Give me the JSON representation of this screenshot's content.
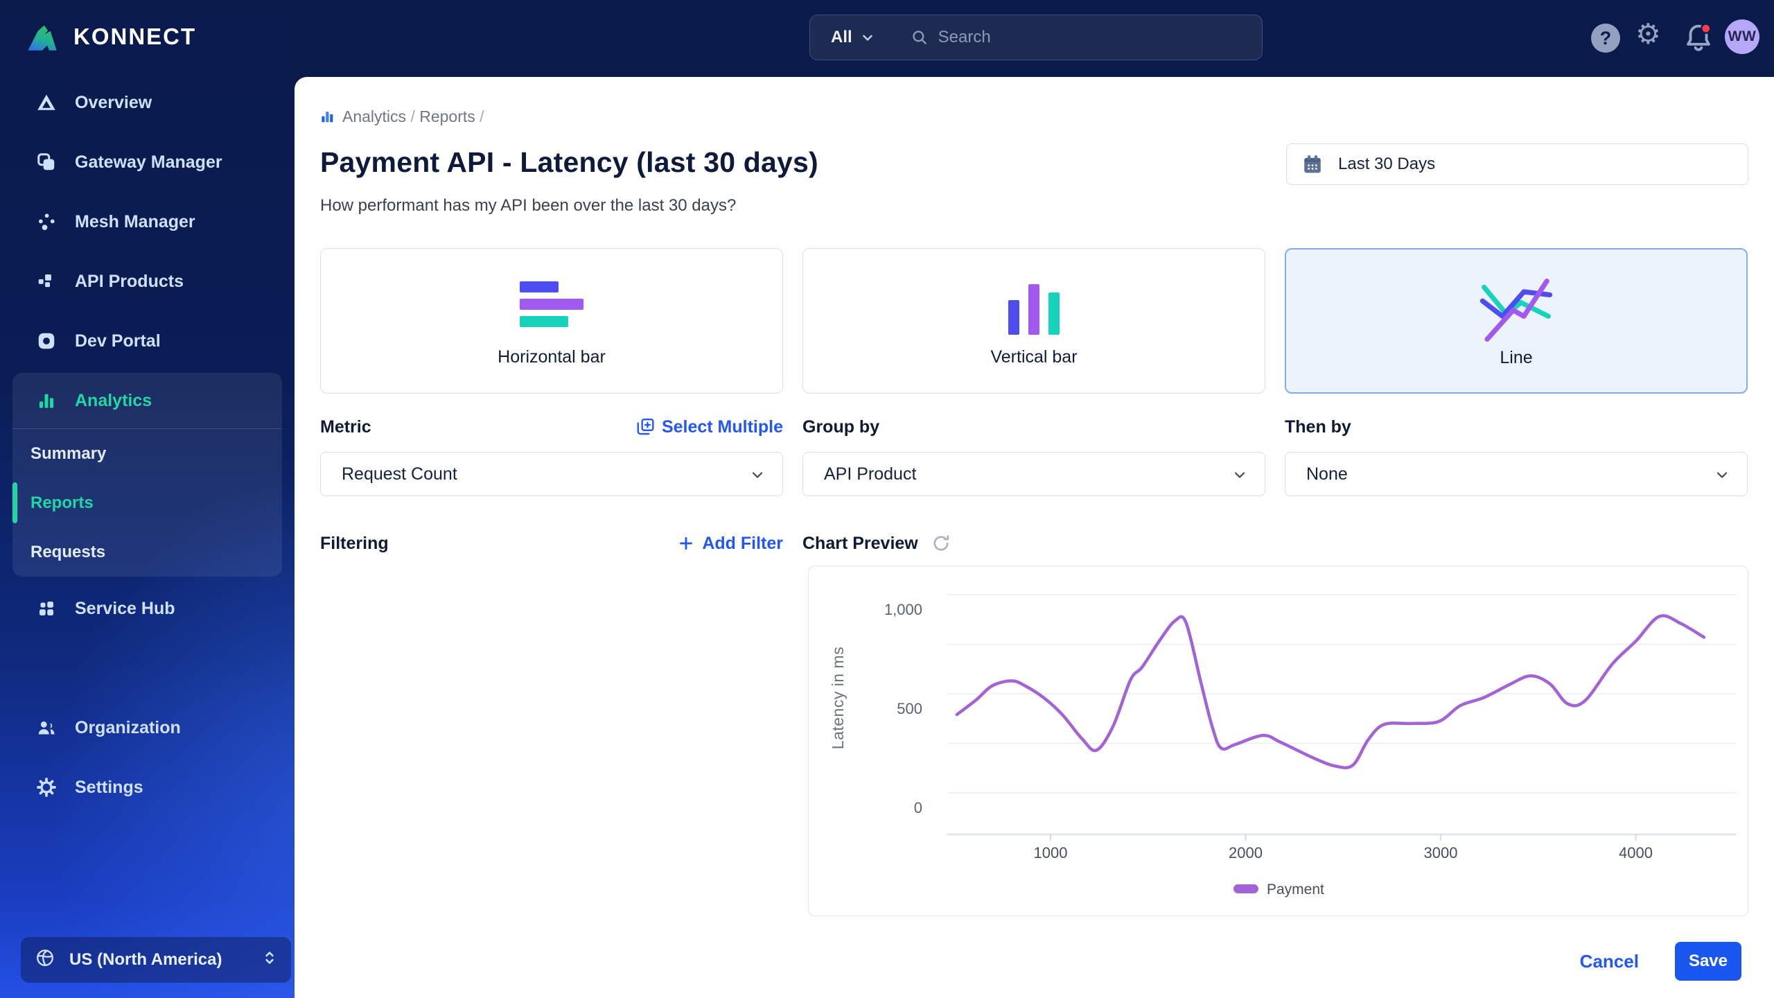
{
  "brand": {
    "logo_text": "KONNECT"
  },
  "topbar": {
    "scope": "All",
    "search_placeholder": "Search",
    "avatar_initials": "WW"
  },
  "sidebar": {
    "items_top": [
      {
        "id": "overview",
        "label": "Overview"
      },
      {
        "id": "gateway-manager",
        "label": "Gateway Manager"
      },
      {
        "id": "mesh-manager",
        "label": "Mesh Manager"
      },
      {
        "id": "api-products",
        "label": "API Products"
      },
      {
        "id": "dev-portal",
        "label": "Dev Portal"
      }
    ],
    "analytics": {
      "id": "analytics",
      "label": "Analytics",
      "items": [
        {
          "label": "Summary",
          "active": false
        },
        {
          "label": "Reports",
          "active": true
        },
        {
          "label": "Requests",
          "active": false
        }
      ]
    },
    "items_mid": [
      {
        "id": "service-hub",
        "label": "Service Hub"
      }
    ],
    "items_bottom": [
      {
        "id": "organization",
        "label": "Organization"
      },
      {
        "id": "settings",
        "label": "Settings"
      }
    ],
    "region": "US (North America)"
  },
  "page": {
    "breadcrumb": [
      "Analytics",
      "Reports"
    ],
    "title": "Payment API - Latency (last 30 days)",
    "subtitle": "How performant has my API been over the last 30 days?",
    "date_range": "Last 30 Days",
    "chart_types": [
      {
        "type": "horizontal-bar",
        "label": "Horizontal bar",
        "selected": false
      },
      {
        "type": "vertical-bar",
        "label": "Vertical bar",
        "selected": false
      },
      {
        "type": "line",
        "label": "Line",
        "selected": true
      }
    ],
    "metric": {
      "label": "Metric",
      "value": "Request Count",
      "action": "Select Multiple"
    },
    "group_by": {
      "label": "Group by",
      "value": "API Product"
    },
    "then_by": {
      "label": "Then by",
      "value": "None"
    },
    "filtering": {
      "label": "Filtering",
      "action": "Add Filter"
    },
    "preview_label": "Chart Preview",
    "actions": {
      "cancel": "Cancel",
      "save": "Save"
    }
  },
  "chart_data": {
    "type": "line",
    "title": "Chart Preview",
    "xlabel": "",
    "ylabel": "Latency in ms",
    "xlim": [
      470,
      4450
    ],
    "ylim": [
      0,
      1140
    ],
    "grid": true,
    "legend_position": "bottom",
    "x_ticks": [
      {
        "v": 1000,
        "label": "1000"
      },
      {
        "v": 2000,
        "label": "2000"
      },
      {
        "v": 3000,
        "label": "3000"
      },
      {
        "v": 4000,
        "label": "4000"
      }
    ],
    "y_ticks": [
      {
        "v": 0,
        "label": "0"
      },
      {
        "v": 500,
        "label": "500"
      },
      {
        "v": 1000,
        "label": "1,000"
      }
    ],
    "gridline_values": [
      0,
      250,
      500,
      750,
      1000
    ],
    "series": [
      {
        "name": "Payment",
        "color": "#a263d6",
        "points": [
          [
            520,
            395
          ],
          [
            620,
            470
          ],
          [
            700,
            540
          ],
          [
            800,
            565
          ],
          [
            870,
            540
          ],
          [
            965,
            480
          ],
          [
            1060,
            395
          ],
          [
            1160,
            275
          ],
          [
            1235,
            215
          ],
          [
            1320,
            335
          ],
          [
            1410,
            570
          ],
          [
            1470,
            635
          ],
          [
            1560,
            770
          ],
          [
            1640,
            870
          ],
          [
            1695,
            858
          ],
          [
            1770,
            560
          ],
          [
            1830,
            330
          ],
          [
            1875,
            225
          ],
          [
            1950,
            245
          ],
          [
            2090,
            290
          ],
          [
            2180,
            255
          ],
          [
            2350,
            175
          ],
          [
            2460,
            135
          ],
          [
            2550,
            140
          ],
          [
            2630,
            270
          ],
          [
            2710,
            345
          ],
          [
            2850,
            350
          ],
          [
            2990,
            360
          ],
          [
            3100,
            440
          ],
          [
            3220,
            480
          ],
          [
            3350,
            545
          ],
          [
            3460,
            590
          ],
          [
            3560,
            550
          ],
          [
            3650,
            450
          ],
          [
            3740,
            465
          ],
          [
            3880,
            650
          ],
          [
            4000,
            765
          ],
          [
            4120,
            890
          ],
          [
            4230,
            855
          ],
          [
            4350,
            785
          ]
        ]
      }
    ]
  },
  "colors": {
    "accent_blue": "#2356f5",
    "save_blue": "#1a57f0",
    "nav_green": "#1fd6a4",
    "line_purple": "#a263d6",
    "bar_blue": "#4d4df0",
    "bar_purple": "#a259ef",
    "bar_teal": "#17d3bb",
    "notification_red": "#f03e4d",
    "avatar_bg": "#b7a7f9"
  }
}
